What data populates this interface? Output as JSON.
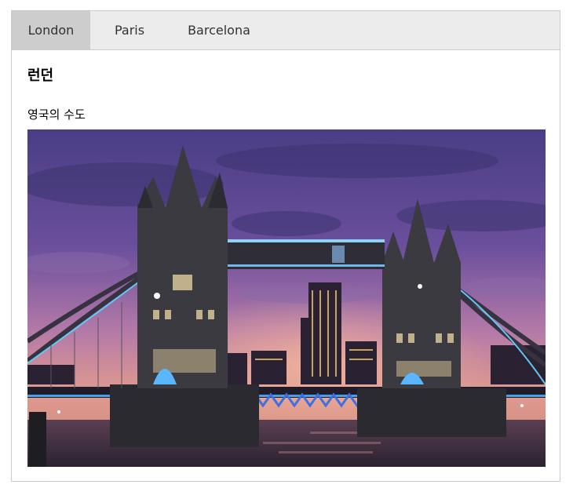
{
  "tabs": [
    {
      "label": "London",
      "active": true
    },
    {
      "label": "Paris",
      "active": false
    },
    {
      "label": "Barcelona",
      "active": false
    }
  ],
  "content": {
    "title": "런던",
    "caption": "영국의 수도"
  },
  "colors": {
    "tabbar_bg": "#ececec",
    "active_tab_bg": "#cdcdcd",
    "border": "#cccccc"
  }
}
